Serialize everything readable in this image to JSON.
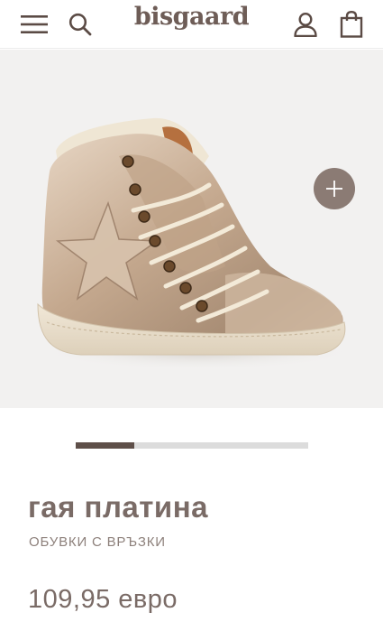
{
  "header": {
    "logo_text": "bisgaard",
    "menu_icon": "hamburger-menu-icon",
    "search_icon": "search-icon",
    "account_icon": "user-icon",
    "bag_icon": "shopping-bag-icon"
  },
  "gallery": {
    "image_subject": "metallic platinum high-top lace-up sneaker with star detail",
    "zoom_icon": "plus-icon",
    "pager_progress_fraction": 0.25
  },
  "product": {
    "title": "гая платина",
    "subtitle": "ОБУВКИ С ВРЪЗКИ",
    "price": "109,95 евро"
  },
  "colors": {
    "brand": "#6e5d57",
    "text": "#7a6b66",
    "zoom_button": "#8b7b74",
    "pager_active": "#5e4f49",
    "pager_track": "#dcdcdc",
    "gallery_bg": "#f2f1f0"
  }
}
